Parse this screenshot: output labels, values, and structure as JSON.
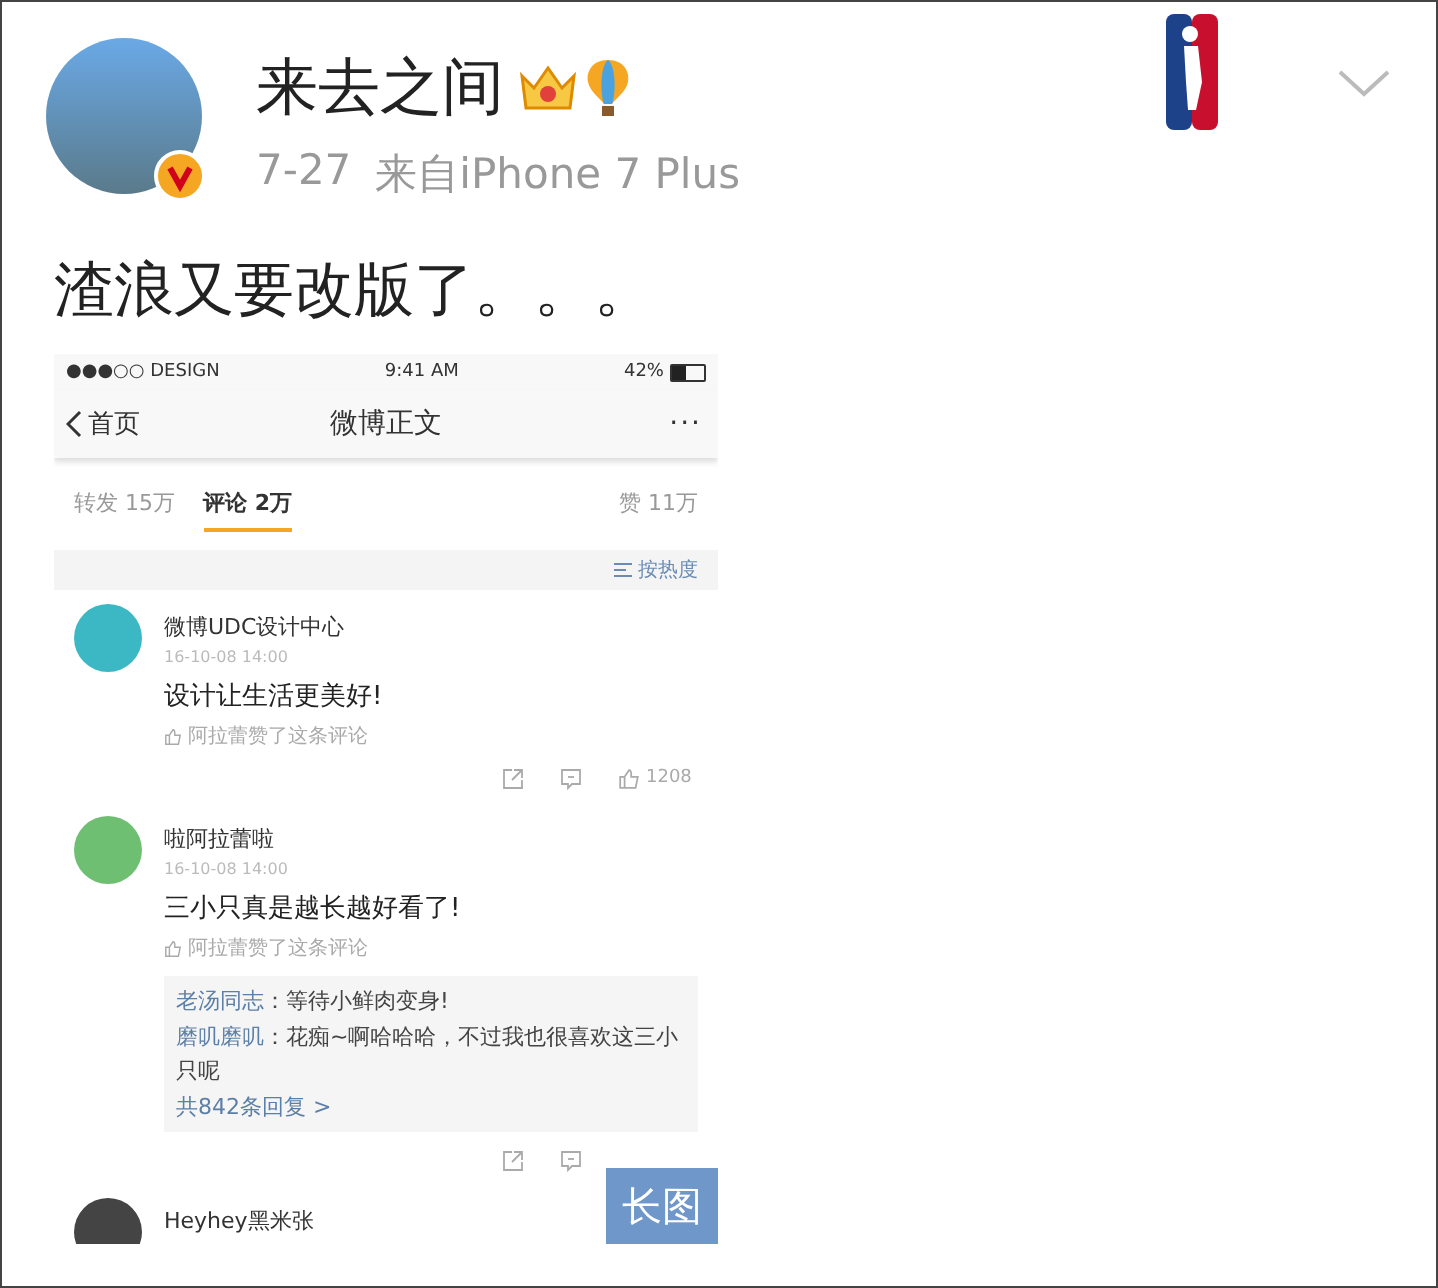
{
  "post": {
    "author": "来去之间",
    "date": "7-27",
    "source": "来自iPhone 7 Plus",
    "text": "渣浪又要改版了。。。"
  },
  "screenshot": {
    "status_bar": {
      "carrier": "●●●○○ DESIGN",
      "time": "9:41 AM",
      "battery": "42%"
    },
    "nav": {
      "back": "首页",
      "title": "微博正文",
      "more": "···"
    },
    "tabs": [
      {
        "label": "转发",
        "count": "15万",
        "selected": false
      },
      {
        "label": "评论",
        "count": "2万",
        "selected": true
      }
    ],
    "likes": "赞 11万",
    "sort": "按热度",
    "comments": [
      {
        "kind": "brand",
        "name": "微博UDC设计中心",
        "time": "16-10-08 14:00",
        "text": "设计让生活更美好!",
        "liked_by": "阿拉蕾赞了这条评论",
        "likes": "1208"
      },
      {
        "kind": "cartoon",
        "name": "啦阿拉蕾啦",
        "time": "16-10-08 14:00",
        "text": "三小只真是越长越好看了!",
        "liked_by": "阿拉蕾赞了这条评论",
        "replies": [
          {
            "name": "老汤同志",
            "text": "：等待小鲜肉变身!"
          },
          {
            "name": "磨叽磨叽",
            "text": "：花痴~啊哈哈哈，不过我也很喜欢这三小只呢"
          }
        ],
        "more_replies": "共842条回复 >"
      },
      {
        "kind": "photo",
        "name": "Heyhey黑米张"
      }
    ],
    "long_image_badge": "长图"
  }
}
